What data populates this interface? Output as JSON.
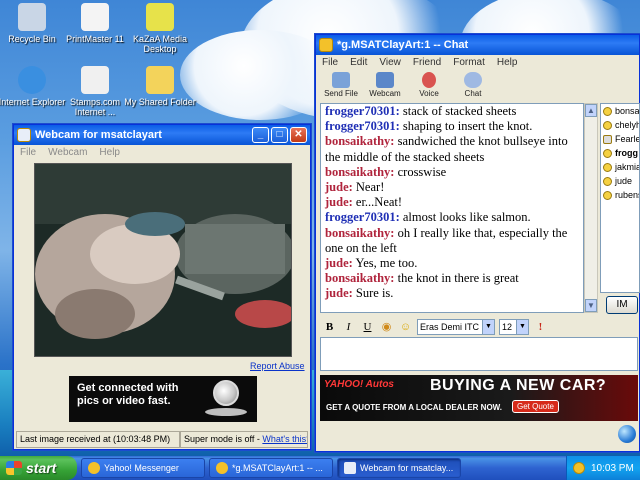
{
  "desktop": {
    "icons": [
      {
        "label": "Recycle Bin",
        "icon": "recycle-bin-icon",
        "color": "#c9d6e6"
      },
      {
        "label": "PrintMaster 11",
        "icon": "printmaster-icon",
        "color": "#f4f4f4"
      },
      {
        "label": "KaZaA Media Desktop",
        "icon": "kazaa-icon",
        "color": "#e7e24a"
      },
      {
        "label": "Internet Explorer",
        "icon": "internet-explorer-icon",
        "color": "#3a8fe0"
      },
      {
        "label": "Stamps.com Internet ...",
        "icon": "stamps-icon",
        "color": "#f0f0f0"
      },
      {
        "label": "My Shared Folder",
        "icon": "shared-folder-icon",
        "color": "#f3d35b"
      }
    ]
  },
  "webcam_window": {
    "title": "Webcam for msatclayart",
    "menu": [
      "File",
      "Webcam",
      "Help"
    ],
    "report_abuse": "Report Abuse",
    "ad_text": "Get connected with pics or video fast.",
    "status_last_image": "Last image received at (10:03:48 PM)",
    "status_super_mode": "Super mode is off - ",
    "status_whats_this": "What's this?"
  },
  "chat_window": {
    "title": "*g.MSATClayArt:1 -- Chat",
    "menu": [
      "File",
      "Edit",
      "View",
      "Friend",
      "Format",
      "Help"
    ],
    "toolbar": [
      {
        "label": "Send File",
        "icon": "send-file-icon",
        "color": "#7aa2d8"
      },
      {
        "label": "Webcam",
        "icon": "webcam-icon",
        "color": "#5b87c9"
      },
      {
        "label": "Voice",
        "icon": "voice-icon",
        "color": "#d9534f"
      },
      {
        "label": "Chat",
        "icon": "chat-icon",
        "color": "#9fb9e3"
      }
    ],
    "messages": [
      {
        "nick": "frogger70301:",
        "text": " stack of stacked sheets",
        "kind": "frog"
      },
      {
        "nick": "frogger70301:",
        "text": " shaping to insert the knot.",
        "kind": "frog"
      },
      {
        "nick": "bonsaikathy:",
        "text": " sandwiched the knot bullseye into the middle of the stacked sheets",
        "kind": "bons"
      },
      {
        "nick": "bonsaikathy:",
        "text": " crosswise",
        "kind": "bons"
      },
      {
        "nick": "jude:",
        "text": " Near!",
        "kind": "jude"
      },
      {
        "nick": "jude:",
        "text": " er...Neat!",
        "kind": "jude"
      },
      {
        "nick": "frogger70301:",
        "text": " almost looks like salmon.",
        "kind": "frog"
      },
      {
        "nick": "bonsaikathy:",
        "text": " oh I really like that, especially the one on the left",
        "kind": "bons"
      },
      {
        "nick": "jude:",
        "text": " Yes, me too.",
        "kind": "jude"
      },
      {
        "nick": "bonsaikathy:",
        "text": " the knot in there is great",
        "kind": "bons"
      },
      {
        "nick": "jude:",
        "text": " Sure is.",
        "kind": "jude"
      }
    ],
    "users": [
      {
        "name": "bonsa",
        "bold": false
      },
      {
        "name": "chelyh",
        "bold": false
      },
      {
        "name": "Fearle",
        "bold": false
      },
      {
        "name": "frogg",
        "bold": true
      },
      {
        "name": "jakmia",
        "bold": false
      },
      {
        "name": "jude",
        "bold": false
      },
      {
        "name": "rubens",
        "bold": false
      }
    ],
    "im_button": "IM",
    "format": {
      "bold": "B",
      "italic": "I",
      "underline": "U",
      "font": "Eras Demi ITC",
      "size": "12"
    },
    "ad": {
      "brand": "YAHOO! Autos",
      "headline": "BUYING A NEW CAR?",
      "sub": "GET A QUOTE FROM A LOCAL DEALER NOW.",
      "cta": "Get Quote"
    }
  },
  "taskbar": {
    "start": "start",
    "tasks": [
      {
        "label": "Yahoo! Messenger",
        "active": false
      },
      {
        "label": "*g.MSATClayArt:1 -- ...",
        "active": false
      },
      {
        "label": "Webcam for msatclay...",
        "active": true
      }
    ],
    "clock": "10:03 PM"
  },
  "colors": {
    "xp_blue": "#0a5ce6",
    "link_blue": "#0a33c9",
    "nick_blue": "#1f2fb5",
    "nick_red": "#b0243c"
  }
}
